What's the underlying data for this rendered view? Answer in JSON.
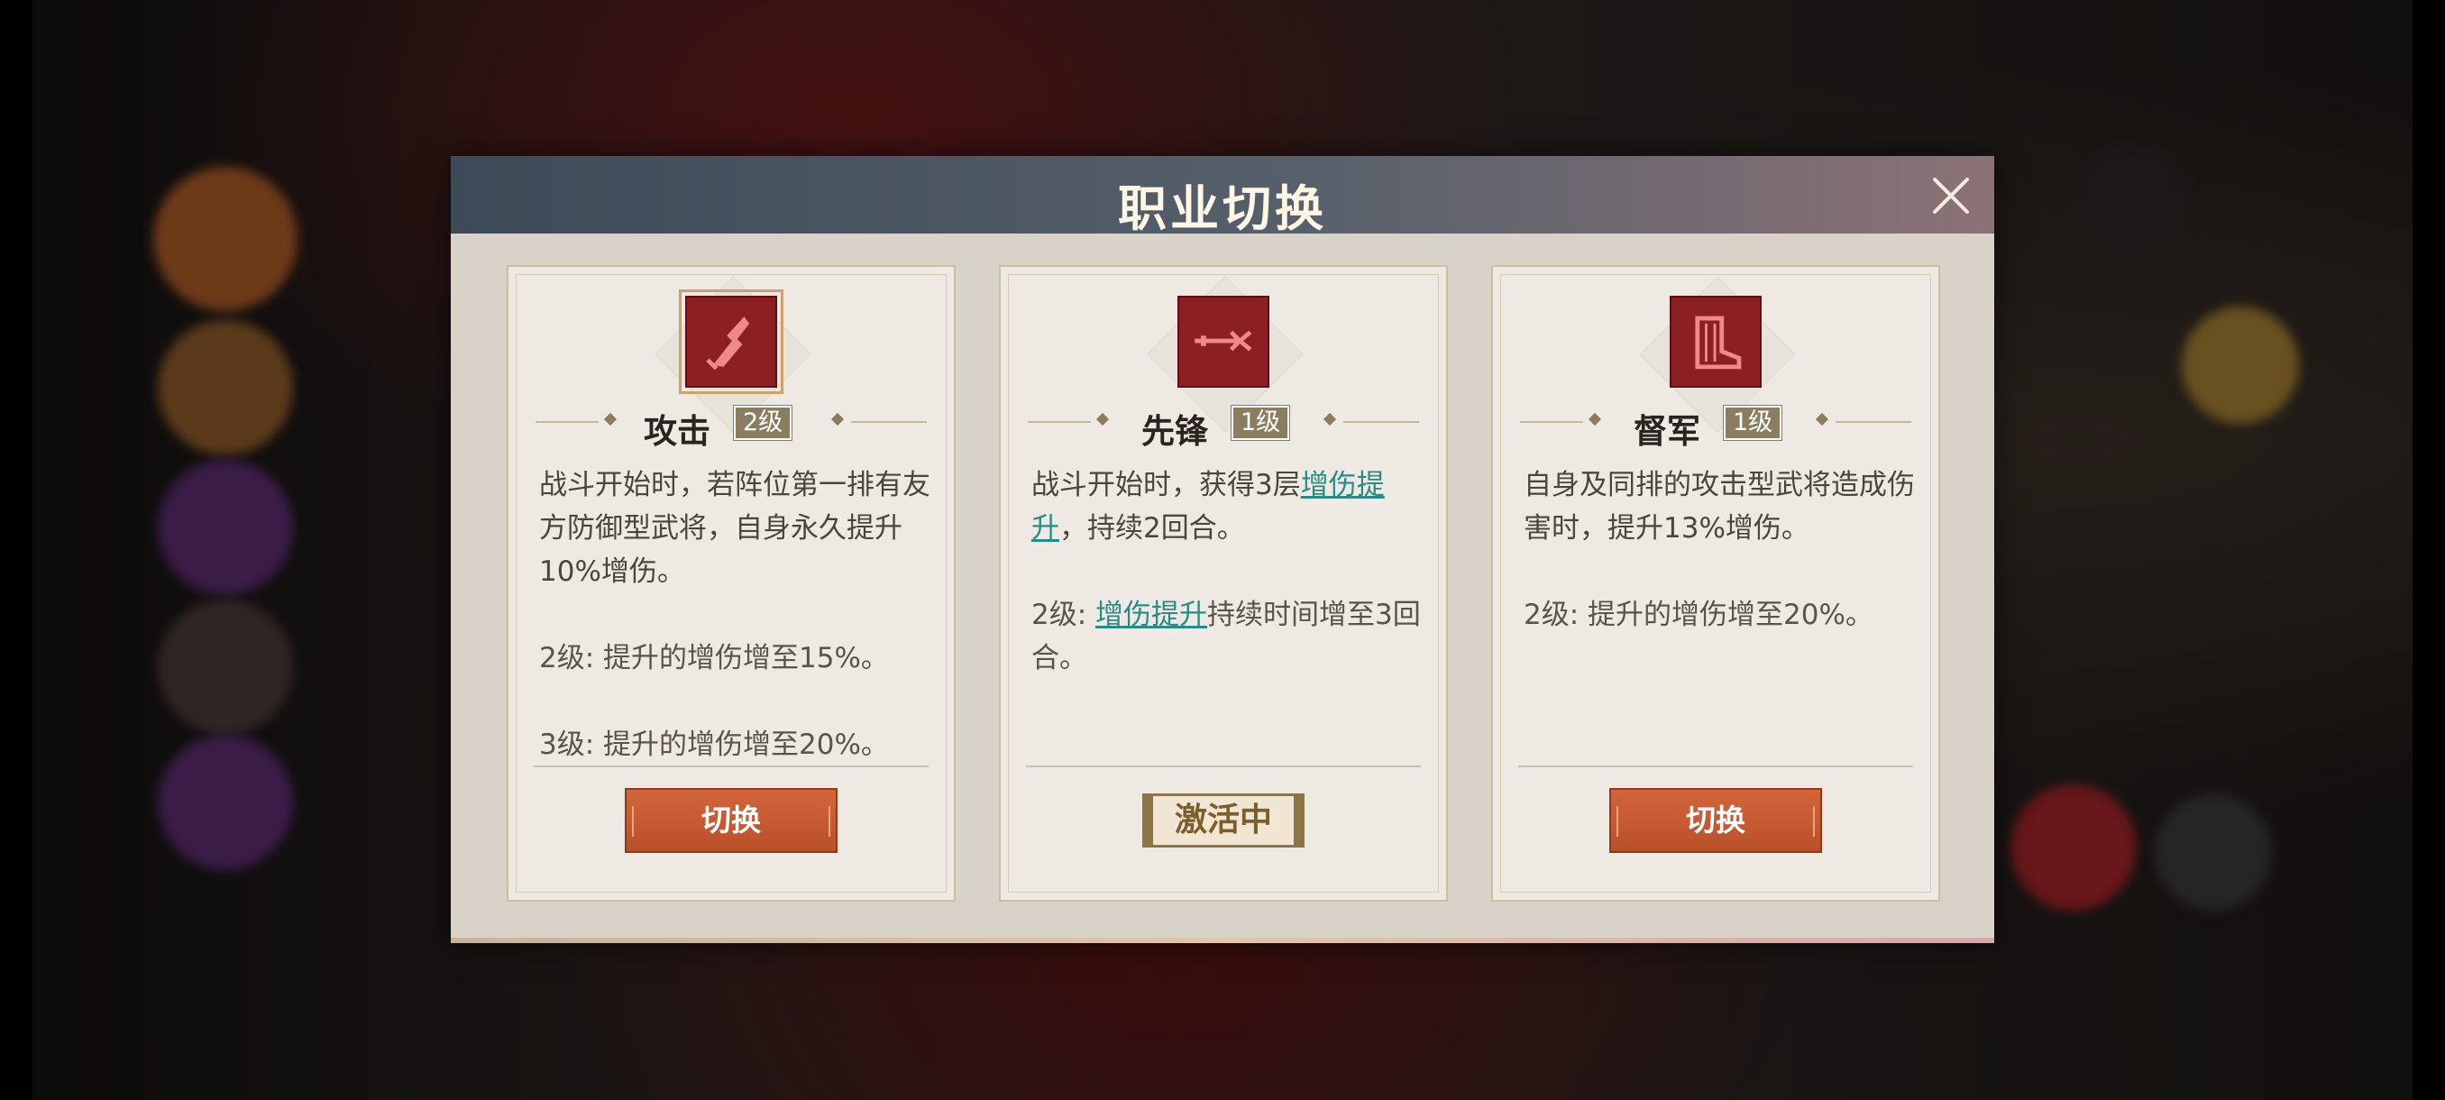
{
  "dialog": {
    "title": "职业切换"
  },
  "cards": [
    {
      "name": "攻击",
      "level": "2级",
      "icon": "attack-claw-icon",
      "desc": [
        "战斗开始时，若阵位第一排有友方防御型武将，自身永久提升10%增伤。"
      ],
      "levels": [
        "2级: 提升的增伤增至15%。",
        "3级: 提升的增伤增至20%。"
      ],
      "button": "切换"
    },
    {
      "name": "先锋",
      "level": "1级",
      "icon": "vanguard-spear-icon",
      "desc_pre": "战斗开始时，获得3层",
      "desc_link": "增伤提升",
      "desc_post": "，持续2回合。",
      "lvl2_pre": "2级: ",
      "lvl2_link": "增伤提升",
      "lvl2_post": "持续时间增至3回合。",
      "status": "激活中"
    },
    {
      "name": "督军",
      "level": "1级",
      "icon": "commander-boot-icon",
      "desc": [
        "自身及同排的攻击型武将造成伤害时，提升13%增伤。"
      ],
      "levels": [
        "2级: 提升的增伤增至20%。"
      ],
      "button": "切换"
    }
  ],
  "colors": {
    "accent": "#c65a33",
    "icon_bg": "#8c1f22",
    "link": "#2a8b86"
  }
}
